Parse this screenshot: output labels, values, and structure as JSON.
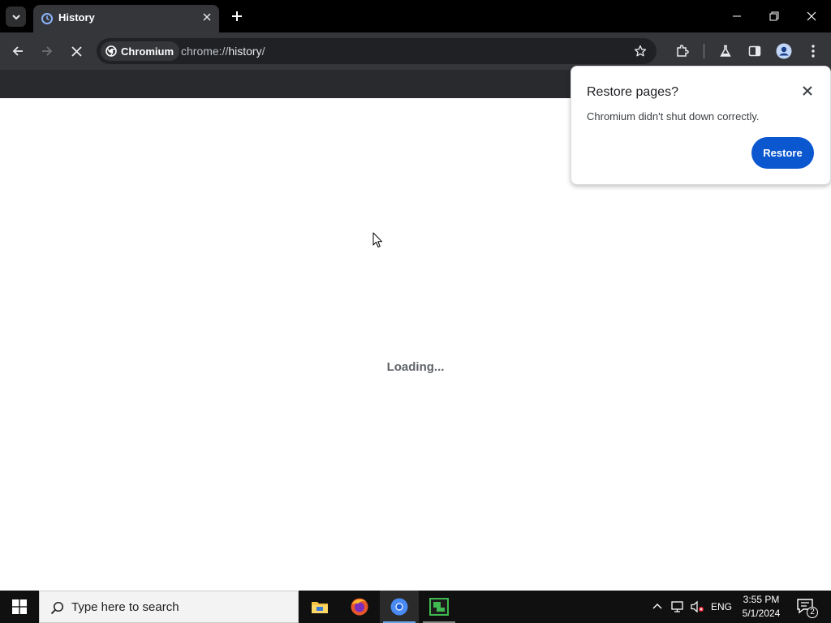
{
  "browser": {
    "tab": {
      "title": "History"
    },
    "toolbar": {
      "site_chip_label": "Chromium",
      "url_scheme": "chrome://",
      "url_host": "history",
      "url_path": "/"
    }
  },
  "page": {
    "loading_text": "Loading..."
  },
  "restore_bubble": {
    "title": "Restore pages?",
    "message": "Chromium didn't shut down correctly.",
    "restore_label": "Restore"
  },
  "taskbar": {
    "search_placeholder": "Type here to search",
    "language": "ENG",
    "time": "3:55 PM",
    "date": "5/1/2024",
    "notification_count": "2",
    "pinned_apps": [
      "file-explorer",
      "firefox",
      "chromium",
      "terminal-app"
    ]
  },
  "colors": {
    "tabstrip_bg": "#000000",
    "toolbar_bg": "#35363a",
    "omnibox_bg": "#202124",
    "accent_blue": "#0b57d0",
    "taskbar_bg": "#101010"
  }
}
